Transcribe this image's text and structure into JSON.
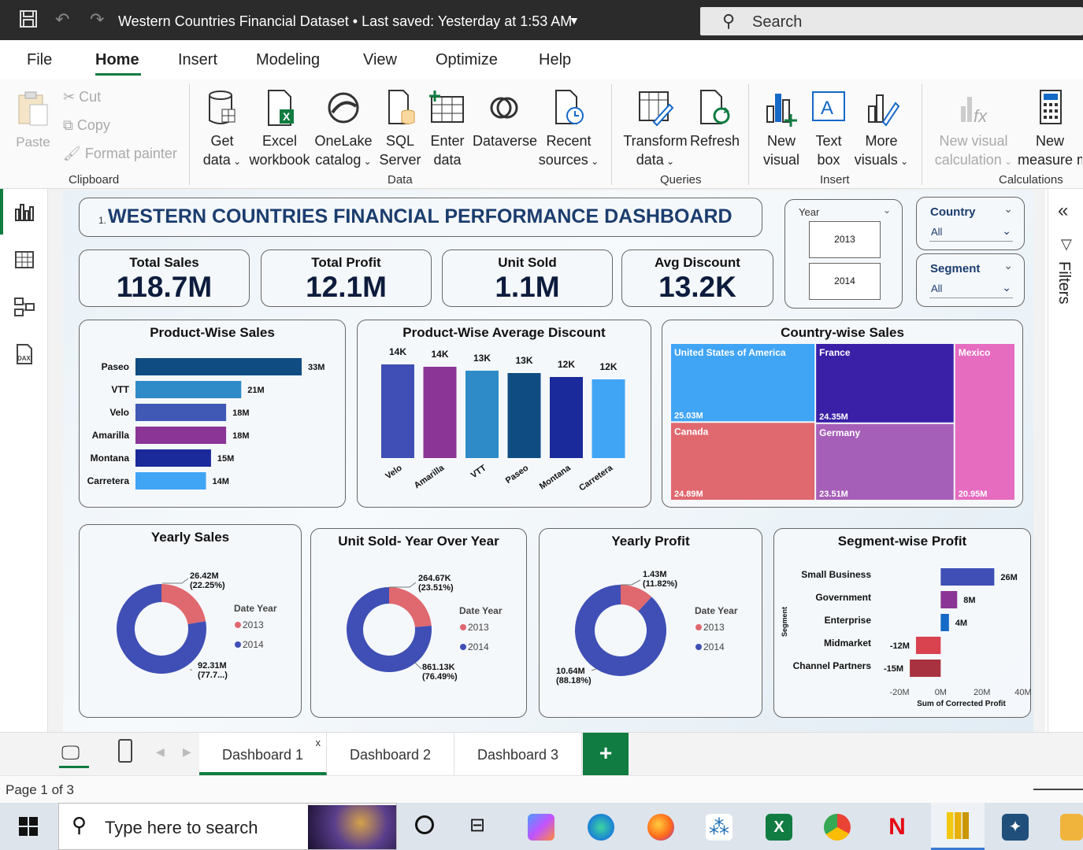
{
  "titlebar": {
    "title": "Western Countries Financial Dataset • Last saved: Yesterday at 1:53 AM",
    "search_placeholder": "Search"
  },
  "menu": [
    "File",
    "Home",
    "Insert",
    "Modeling",
    "View",
    "Optimize",
    "Help"
  ],
  "ribbon": {
    "clipboard": {
      "paste": "Paste",
      "cut": "Cut",
      "copy": "Copy",
      "format_painter": "Format painter",
      "group": "Clipboard"
    },
    "data": {
      "get_data_1": "Get",
      "get_data_2": "data",
      "excel_1": "Excel",
      "excel_2": "workbook",
      "onelake_1": "OneLake",
      "onelake_2": "catalog",
      "sql_1": "SQL",
      "sql_2": "Server",
      "enter_1": "Enter",
      "enter_2": "data",
      "dataverse": "Dataverse",
      "recent_1": "Recent",
      "recent_2": "sources",
      "group": "Data"
    },
    "queries": {
      "transform_1": "Transform",
      "transform_2": "data",
      "refresh": "Refresh",
      "group": "Queries"
    },
    "insert": {
      "new_visual_1": "New",
      "new_visual_2": "visual",
      "text_box_1": "Text",
      "text_box_2": "box",
      "more_visuals_1": "More",
      "more_visuals_2": "visuals",
      "group": "Insert"
    },
    "calculations": {
      "new_vis_calc_1": "New visual",
      "new_vis_calc_2": "calculation",
      "new_measure_1": "New",
      "new_measure_2": "measure m",
      "group": "Calculations"
    }
  },
  "dashboard": {
    "title_prefix": "1.",
    "title": "WESTERN COUNTRIES FINANCIAL PERFORMANCE DASHBOARD",
    "kpis": [
      {
        "label": "Total Sales",
        "value": "118.7M"
      },
      {
        "label": "Total Profit",
        "value": "12.1M"
      },
      {
        "label": "Unit Sold",
        "value": "1.1M"
      },
      {
        "label": "Avg Discount",
        "value": "13.2K"
      }
    ],
    "year_slicer": {
      "label": "Year",
      "options": [
        "2013",
        "2014"
      ]
    },
    "country_slicer": {
      "label": "Country",
      "value": "All"
    },
    "segment_slicer": {
      "label": "Segment",
      "value": "All"
    },
    "product_sales_title": "Product-Wise Sales",
    "product_discount_title": "Product-Wise Average Discount",
    "country_sales_title": "Country-wise Sales",
    "yearly_sales_title": "Yearly Sales",
    "unit_sold_title": "Unit Sold- Year Over Year",
    "yearly_profit_title": "Yearly Profit",
    "segment_profit_title": "Segment-wise Profit"
  },
  "chart_data": [
    {
      "type": "bar",
      "orientation": "horizontal",
      "title": "Product-Wise Sales",
      "categories": [
        "Paseo",
        "VTT",
        "Velo",
        "Amarilla",
        "Montana",
        "Carretera"
      ],
      "values": [
        33,
        21,
        18,
        18,
        15,
        14
      ],
      "labels": [
        "33M",
        "21M",
        "18M",
        "18M",
        "15M",
        "14M"
      ],
      "colors": [
        "#0f4c81",
        "#2e8bc7",
        "#4059b5",
        "#8b3596",
        "#1a2a9a",
        "#41a5f5"
      ]
    },
    {
      "type": "bar",
      "title": "Product-Wise Average Discount",
      "categories": [
        "Velo",
        "Amarilla",
        "VTT",
        "Paseo",
        "Montana",
        "Carretera"
      ],
      "values": [
        14,
        14,
        13,
        13,
        12,
        12
      ],
      "labels": [
        "14K",
        "14K",
        "13K",
        "13K",
        "12K",
        "12K"
      ],
      "colors": [
        "#3f4fb5",
        "#8b3596",
        "#2e8bc7",
        "#0f4c81",
        "#1a2a9a",
        "#41a5f5"
      ]
    },
    {
      "type": "heatmap",
      "subtype": "treemap",
      "title": "Country-wise Sales",
      "categories": [
        "United States of America",
        "France",
        "Canada",
        "Germany",
        "Mexico"
      ],
      "values": [
        25.03,
        24.35,
        24.89,
        23.51,
        20.95
      ],
      "labels": [
        "25.03M",
        "24.35M",
        "24.89M",
        "23.51M",
        "20.95M"
      ],
      "colors": [
        "#41a5f5",
        "#3a1fa7",
        "#e0686f",
        "#a65fb8",
        "#e66cc0"
      ]
    },
    {
      "type": "pie",
      "subtype": "donut",
      "title": "Yearly Sales",
      "legend_title": "Date Year",
      "categories": [
        "2013",
        "2014"
      ],
      "values": [
        26.42,
        92.31
      ],
      "labels": [
        "26.42M\n(22.25%)",
        "92.31M\n(77.7...)"
      ],
      "colors": [
        "#e0686f",
        "#3f4fb5"
      ]
    },
    {
      "type": "pie",
      "subtype": "donut",
      "title": "Unit Sold- Year Over Year",
      "legend_title": "Date Year",
      "categories": [
        "2013",
        "2014"
      ],
      "values": [
        264.67,
        861.13
      ],
      "labels": [
        "264.67K\n(23.51%)",
        "861.13K\n(76.49%)"
      ],
      "colors": [
        "#e0686f",
        "#3f4fb5"
      ]
    },
    {
      "type": "pie",
      "subtype": "donut",
      "title": "Yearly Profit",
      "legend_title": "Date Year",
      "categories": [
        "2013",
        "2014"
      ],
      "values": [
        1.43,
        10.64
      ],
      "labels": [
        "1.43M\n(11.82%)",
        "10.64M\n(88.18%)"
      ],
      "colors": [
        "#e0686f",
        "#3f4fb5"
      ]
    },
    {
      "type": "bar",
      "orientation": "horizontal",
      "title": "Segment-wise Profit",
      "ylabel": "Segment",
      "xlabel": "Sum of Corrected Profit",
      "categories": [
        "Small Business",
        "Government",
        "Enterprise",
        "Midmarket",
        "Channel Partners"
      ],
      "values": [
        26,
        8,
        4,
        -12,
        -15
      ],
      "labels": [
        "26M",
        "8M",
        "4M",
        "-12M",
        "-15M"
      ],
      "xlim": [
        -20,
        40
      ],
      "xticks": [
        "-20M",
        "0M",
        "20M",
        "40M"
      ],
      "colors": [
        "#3f4fb5",
        "#8b3596",
        "#1569c7",
        "#d9424f",
        "#a8323f"
      ]
    }
  ],
  "tabs": [
    "Dashboard 1",
    "Dashboard 2",
    "Dashboard 3"
  ],
  "tab_close": "x",
  "add_tab": "+",
  "status": {
    "page": "Page 1 of 3"
  },
  "filters_label": "Filters",
  "taskbar": {
    "search_placeholder": "Type here to search"
  }
}
